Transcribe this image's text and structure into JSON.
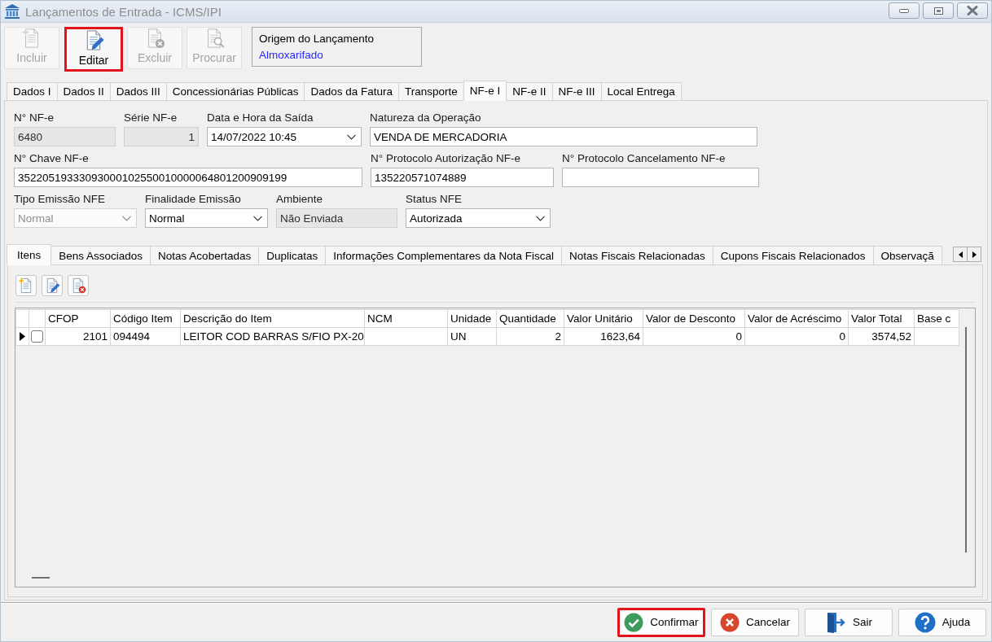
{
  "window": {
    "title": "Lançamentos de Entrada - ICMS/IPI",
    "active": false
  },
  "toolbar": [
    {
      "label": "Incluir",
      "kind": "new",
      "disabled": true,
      "highlighted": false
    },
    {
      "label": "Editar",
      "kind": "edit",
      "disabled": false,
      "highlighted": true
    },
    {
      "label": "Excluir",
      "kind": "delete",
      "disabled": true,
      "highlighted": false
    },
    {
      "label": "Procurar",
      "kind": "search",
      "disabled": true,
      "highlighted": false
    }
  ],
  "origin": {
    "label": "Origem do Lançamento",
    "value": "Almoxarifado"
  },
  "tabs": [
    {
      "label": "Dados I",
      "selected": false
    },
    {
      "label": "Dados II",
      "selected": false
    },
    {
      "label": "Dados III",
      "selected": false
    },
    {
      "label": "Concessionárias Públicas",
      "selected": false
    },
    {
      "label": "Dados da Fatura",
      "selected": false
    },
    {
      "label": "Transporte",
      "selected": false
    },
    {
      "label": "NF-e I",
      "selected": true
    },
    {
      "label": "NF-e II",
      "selected": false
    },
    {
      "label": "NF-e III",
      "selected": false
    },
    {
      "label": "Local Entrega",
      "selected": false
    }
  ],
  "fields": [
    {
      "label": "N° NF-e",
      "kind": "readonly",
      "value": "6480",
      "disabled": false
    },
    {
      "label": "Série NF-e",
      "kind": "number",
      "value": "1",
      "disabled": false
    },
    {
      "label": "Data e Hora da Saída",
      "kind": "combo",
      "value": "14/07/2022 10:45",
      "disabled": false
    },
    {
      "label": "Natureza da Operação",
      "kind": "text",
      "value": "VENDA DE MERCADORIA",
      "disabled": false
    },
    {
      "label": "N° Chave NF-e",
      "kind": "text",
      "value": "35220519333093000102550010000064801200909199",
      "disabled": false
    },
    {
      "label": "N° Protocolo Autorização NF-e",
      "kind": "text",
      "value": "135220571074889",
      "disabled": false
    },
    {
      "label": "N° Protocolo Cancelamento NF-e",
      "kind": "text",
      "disabled": false
    },
    {
      "label": "Tipo Emissão NFE",
      "kind": "combo",
      "value": "Normal",
      "disabled": true
    },
    {
      "label": "Finalidade Emissão",
      "kind": "combo",
      "value": "Normal",
      "disabled": false
    },
    {
      "label": "Ambiente",
      "kind": "readonly",
      "value": "Não Enviada",
      "disabled": false
    },
    {
      "label": "Status NFE",
      "kind": "combo",
      "value": "Autorizada",
      "disabled": false
    }
  ],
  "subtabs": [
    {
      "label": "Itens",
      "selected": true
    },
    {
      "label": "Bens Associados",
      "selected": false
    },
    {
      "label": "Notas Acobertadas",
      "selected": false
    },
    {
      "label": "Duplicatas",
      "selected": false
    },
    {
      "label": "Informações Complementares da Nota Fiscal",
      "selected": false
    },
    {
      "label": "Notas Fiscais Relacionadas",
      "selected": false
    },
    {
      "label": "Cupons Fiscais Relacionados",
      "selected": false
    },
    {
      "label": "Observaçã",
      "selected": false
    }
  ],
  "grid": {
    "columns": [
      "CFOP",
      "Código Item",
      "Descrição do Item",
      "NCM",
      "Unidade",
      "Quantidade",
      "Valor Unitário",
      "Valor de Desconto",
      "Valor de Acréscimo",
      "Valor Total",
      "Base c"
    ],
    "rows": [
      {
        "current": true,
        "checked": false,
        "cells": [
          "2101",
          "094494",
          "LEITOR COD BARRAS S/FIO PX-20",
          null,
          "UN",
          "2",
          "1623,64",
          "0",
          "0",
          "3574,52",
          null
        ]
      }
    ]
  },
  "footer": {
    "buttons": [
      {
        "label": "Confirmar",
        "kind": "confirm",
        "highlighted": true
      },
      {
        "label": "Cancelar",
        "kind": "cancel",
        "highlighted": false
      },
      {
        "label": "Sair",
        "kind": "exit",
        "highlighted": false
      },
      {
        "label": "Ajuda",
        "kind": "help",
        "highlighted": false
      }
    ]
  }
}
